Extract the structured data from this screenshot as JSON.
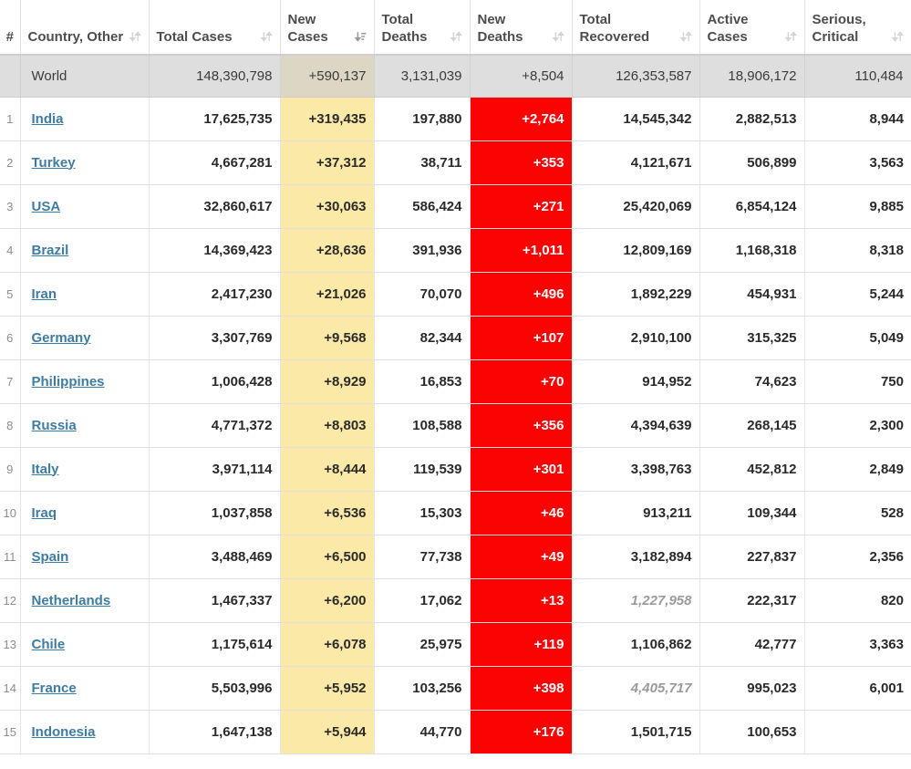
{
  "table": {
    "columns": [
      {
        "key": "rank",
        "label": "#",
        "sort": "none",
        "align": "center"
      },
      {
        "key": "country",
        "label": "Country, Other",
        "sort": "sortable",
        "align": "left"
      },
      {
        "key": "tcases",
        "label": "Total Cases",
        "sort": "sortable",
        "align": "right"
      },
      {
        "key": "ncases",
        "label": "New Cases",
        "sort": "desc-active",
        "align": "right"
      },
      {
        "key": "tdeaths",
        "label": "Total Deaths",
        "sort": "sortable",
        "align": "right"
      },
      {
        "key": "ndeaths",
        "label": "New Deaths",
        "sort": "sortable",
        "align": "right"
      },
      {
        "key": "trec",
        "label": "Total Recovered",
        "sort": "sortable",
        "align": "right"
      },
      {
        "key": "active",
        "label": "Active Cases",
        "sort": "sortable",
        "align": "right"
      },
      {
        "key": "serious",
        "label": "Serious, Critical",
        "sort": "sortable",
        "align": "right"
      }
    ],
    "world_row": {
      "rank": "",
      "country": "World",
      "tcases": "148,390,798",
      "ncases": "+590,137",
      "tdeaths": "3,131,039",
      "ndeaths": "+8,504",
      "trec": "126,353,587",
      "active": "18,906,172",
      "serious": "110,484"
    },
    "rows": [
      {
        "rank": "1",
        "country": "India",
        "tcases": "17,625,735",
        "ncases": "+319,435",
        "tdeaths": "197,880",
        "ndeaths": "+2,764",
        "trec": "14,545,342",
        "active": "2,882,513",
        "serious": "8,944",
        "trec_muted": false
      },
      {
        "rank": "2",
        "country": "Turkey",
        "tcases": "4,667,281",
        "ncases": "+37,312",
        "tdeaths": "38,711",
        "ndeaths": "+353",
        "trec": "4,121,671",
        "active": "506,899",
        "serious": "3,563",
        "trec_muted": false
      },
      {
        "rank": "3",
        "country": "USA",
        "tcases": "32,860,617",
        "ncases": "+30,063",
        "tdeaths": "586,424",
        "ndeaths": "+271",
        "trec": "25,420,069",
        "active": "6,854,124",
        "serious": "9,885",
        "trec_muted": false
      },
      {
        "rank": "4",
        "country": "Brazil",
        "tcases": "14,369,423",
        "ncases": "+28,636",
        "tdeaths": "391,936",
        "ndeaths": "+1,011",
        "trec": "12,809,169",
        "active": "1,168,318",
        "serious": "8,318",
        "trec_muted": false
      },
      {
        "rank": "5",
        "country": "Iran",
        "tcases": "2,417,230",
        "ncases": "+21,026",
        "tdeaths": "70,070",
        "ndeaths": "+496",
        "trec": "1,892,229",
        "active": "454,931",
        "serious": "5,244",
        "trec_muted": false
      },
      {
        "rank": "6",
        "country": "Germany",
        "tcases": "3,307,769",
        "ncases": "+9,568",
        "tdeaths": "82,344",
        "ndeaths": "+107",
        "trec": "2,910,100",
        "active": "315,325",
        "serious": "5,049",
        "trec_muted": false
      },
      {
        "rank": "7",
        "country": "Philippines",
        "tcases": "1,006,428",
        "ncases": "+8,929",
        "tdeaths": "16,853",
        "ndeaths": "+70",
        "trec": "914,952",
        "active": "74,623",
        "serious": "750",
        "trec_muted": false
      },
      {
        "rank": "8",
        "country": "Russia",
        "tcases": "4,771,372",
        "ncases": "+8,803",
        "tdeaths": "108,588",
        "ndeaths": "+356",
        "trec": "4,394,639",
        "active": "268,145",
        "serious": "2,300",
        "trec_muted": false
      },
      {
        "rank": "9",
        "country": "Italy",
        "tcases": "3,971,114",
        "ncases": "+8,444",
        "tdeaths": "119,539",
        "ndeaths": "+301",
        "trec": "3,398,763",
        "active": "452,812",
        "serious": "2,849",
        "trec_muted": false
      },
      {
        "rank": "10",
        "country": "Iraq",
        "tcases": "1,037,858",
        "ncases": "+6,536",
        "tdeaths": "15,303",
        "ndeaths": "+46",
        "trec": "913,211",
        "active": "109,344",
        "serious": "528",
        "trec_muted": false
      },
      {
        "rank": "11",
        "country": "Spain",
        "tcases": "3,488,469",
        "ncases": "+6,500",
        "tdeaths": "77,738",
        "ndeaths": "+49",
        "trec": "3,182,894",
        "active": "227,837",
        "serious": "2,356",
        "trec_muted": false
      },
      {
        "rank": "12",
        "country": "Netherlands",
        "tcases": "1,467,337",
        "ncases": "+6,200",
        "tdeaths": "17,062",
        "ndeaths": "+13",
        "trec": "1,227,958",
        "active": "222,317",
        "serious": "820",
        "trec_muted": true
      },
      {
        "rank": "13",
        "country": "Chile",
        "tcases": "1,175,614",
        "ncases": "+6,078",
        "tdeaths": "25,975",
        "ndeaths": "+119",
        "trec": "1,106,862",
        "active": "42,777",
        "serious": "3,363",
        "trec_muted": false
      },
      {
        "rank": "14",
        "country": "France",
        "tcases": "5,503,996",
        "ncases": "+5,952",
        "tdeaths": "103,256",
        "ndeaths": "+398",
        "trec": "4,405,717",
        "active": "995,023",
        "serious": "6,001",
        "trec_muted": true
      },
      {
        "rank": "15",
        "country": "Indonesia",
        "tcases": "1,647,138",
        "ncases": "+5,944",
        "tdeaths": "44,770",
        "ndeaths": "+176",
        "trec": "1,501,715",
        "active": "100,653",
        "serious": "",
        "trec_muted": false
      }
    ]
  },
  "colors": {
    "new_cases_highlight": "#fbe9a8",
    "new_deaths_highlight": "#fc0303",
    "world_row_bg": "#dedede",
    "link": "#3d7ca3",
    "muted_text": "#9b9b9b"
  }
}
